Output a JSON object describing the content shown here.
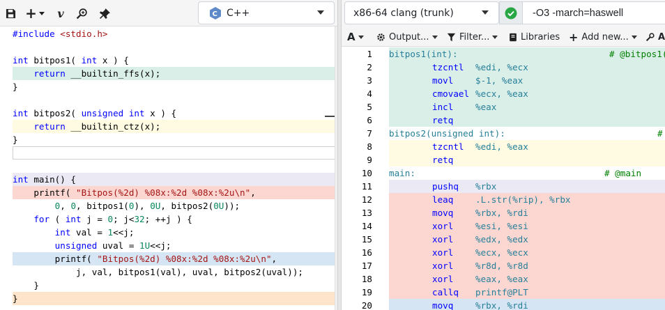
{
  "toolbar": {
    "add_label": "+",
    "vim_label": "v",
    "language": "C++"
  },
  "compiler": {
    "name": "x86-64 clang (trunk)",
    "options": "-O3 -march=haswell"
  },
  "output_toolbar": {
    "font_label": "A",
    "output_label": "Output...",
    "filter_label": "Filter...",
    "libraries_label": "Libraries",
    "add_new_label": "Add new...",
    "more_label": "A"
  },
  "colors": {
    "green": "#dbefe9",
    "yellow": "#fffbe3",
    "lavender": "#ebeaf4",
    "red": "#fcd7d2",
    "blue": "#d6e5f3",
    "orange": "#fde4cb",
    "accent_check": "#28a745"
  },
  "source": [
    {
      "text": "#include <stdio.h>",
      "bg": ""
    },
    {
      "text": "",
      "bg": ""
    },
    {
      "text": "int bitpos1( int x ) {",
      "bg": ""
    },
    {
      "text": "    return __builtin_ffs(x);",
      "bg": "green"
    },
    {
      "text": "}",
      "bg": ""
    },
    {
      "text": "",
      "bg": ""
    },
    {
      "text": "int bitpos2( unsigned int x ) {",
      "bg": ""
    },
    {
      "text": "    return __builtin_ctz(x);",
      "bg": "yellow"
    },
    {
      "text": "}",
      "bg": ""
    },
    {
      "text": "",
      "bg": "boxed"
    },
    {
      "text": "",
      "bg": ""
    },
    {
      "text": "int main() {",
      "bg": "lavender"
    },
    {
      "text": "    printf( \"Bitpos(%2d) %08x:%2d %08x:%2u\\n\",",
      "bg": "red"
    },
    {
      "text": "        0, 0, bitpos1(0), 0U, bitpos2(0U));",
      "bg": ""
    },
    {
      "text": "    for ( int j = 0; j<32; ++j ) {",
      "bg": ""
    },
    {
      "text": "        int val = 1<<j;",
      "bg": ""
    },
    {
      "text": "        unsigned uval = 1U<<j;",
      "bg": ""
    },
    {
      "text": "        printf( \"Bitpos(%2d) %08x:%2d %08x:%2u\\n\",",
      "bg": "blue"
    },
    {
      "text": "            j, val, bitpos1(val), uval, bitpos2(uval));",
      "bg": ""
    },
    {
      "text": "    }",
      "bg": ""
    },
    {
      "text": "}",
      "bg": "orange"
    }
  ],
  "asm": [
    {
      "n": "1",
      "label": "bitpos1(int):",
      "comment": "# @bitpos1(",
      "bg": "green"
    },
    {
      "n": "2",
      "op": "tzcntl",
      "args": "%edi, %ecx",
      "bg": "green"
    },
    {
      "n": "3",
      "op": "movl",
      "args": "$-1, %eax",
      "bg": "green"
    },
    {
      "n": "4",
      "op": "cmovael",
      "args": "%ecx, %eax",
      "bg": "green"
    },
    {
      "n": "5",
      "op": "incl",
      "args": "%eax",
      "bg": "green"
    },
    {
      "n": "6",
      "op": "retq",
      "args": "",
      "bg": "green"
    },
    {
      "n": "7",
      "label": "bitpos2(unsigned int):",
      "comment": "#",
      "bg": ""
    },
    {
      "n": "8",
      "op": "tzcntl",
      "args": "%edi, %eax",
      "bg": "yellow"
    },
    {
      "n": "9",
      "op": "retq",
      "args": "",
      "bg": "yellow"
    },
    {
      "n": "10",
      "label": "main:",
      "comment": "# @main",
      "bg": ""
    },
    {
      "n": "11",
      "op": "pushq",
      "args": "%rbx",
      "bg": "lavender"
    },
    {
      "n": "12",
      "op": "leaq",
      "args": ".L.str(%rip), %rbx",
      "bg": "red"
    },
    {
      "n": "13",
      "op": "movq",
      "args": "%rbx, %rdi",
      "bg": "red"
    },
    {
      "n": "14",
      "op": "xorl",
      "args": "%esi, %esi",
      "bg": "red"
    },
    {
      "n": "15",
      "op": "xorl",
      "args": "%edx, %edx",
      "bg": "red"
    },
    {
      "n": "16",
      "op": "xorl",
      "args": "%ecx, %ecx",
      "bg": "red"
    },
    {
      "n": "17",
      "op": "xorl",
      "args": "%r8d, %r8d",
      "bg": "red"
    },
    {
      "n": "18",
      "op": "xorl",
      "args": "%eax, %eax",
      "bg": "red"
    },
    {
      "n": "19",
      "op": "callq",
      "args": "printf@PLT",
      "bg": "red"
    },
    {
      "n": "20",
      "op": "movq",
      "args": "%rbx, %rdi",
      "bg": "blue"
    }
  ]
}
